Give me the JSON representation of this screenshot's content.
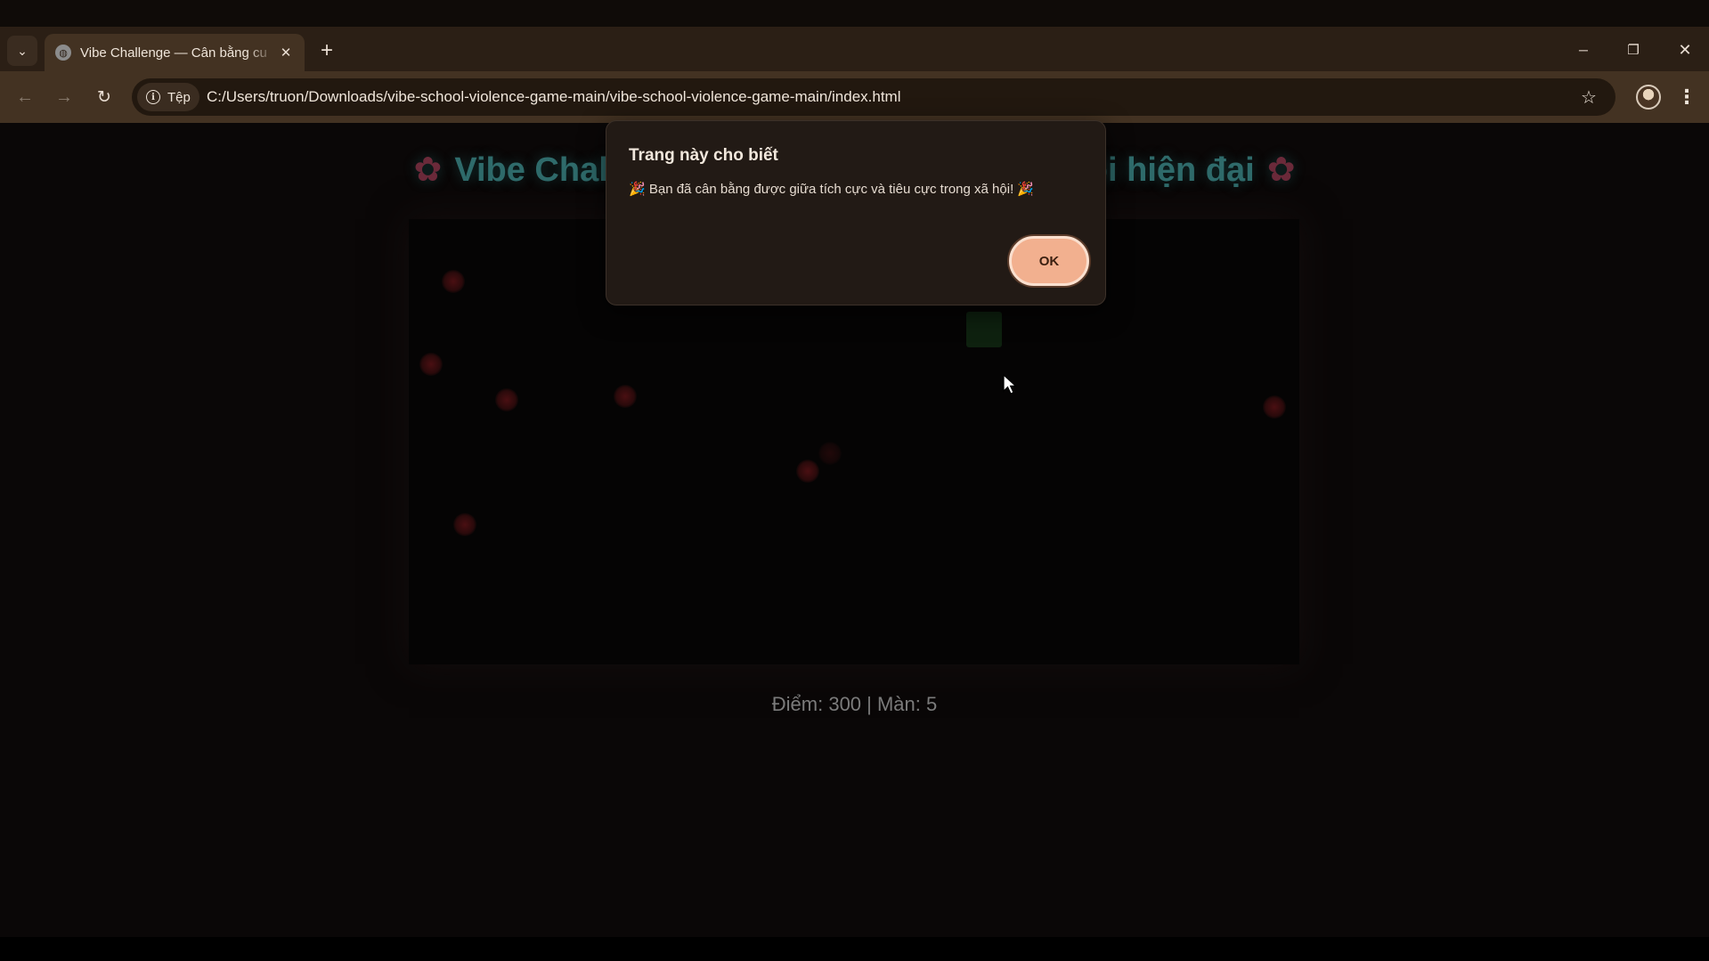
{
  "browser": {
    "tab": {
      "title": "Vibe Challenge — Cân bằng cu",
      "close_glyph": "✕"
    },
    "new_tab_glyph": "+",
    "tab_search_glyph": "⌄",
    "window_controls": {
      "minimize": "─",
      "maximize": "❐",
      "close": "✕"
    },
    "nav": {
      "back": "←",
      "forward": "→",
      "reload": "↻"
    },
    "address_bar": {
      "site_chip_label": "Tệp",
      "url": "C:/Users/truon/Downloads/vibe-school-violence-game-main/vibe-school-violence-game-main/index.html",
      "star_glyph": "☆"
    },
    "menu_glyph": "⋮",
    "theme_colors": {
      "tabstrip": "#2b1f15",
      "toolbar": "#433222",
      "omnibox": "#22180f"
    }
  },
  "page": {
    "title_left": "Vibe Chal",
    "title_right": "ội hiện đại",
    "flower_glyph": "✿",
    "score_text": "Điểm: 300 | Màn: 5",
    "board": {
      "negative_count_visible": 8,
      "colors": {
        "negative": "#4a0f12",
        "player": "#0e210f"
      }
    }
  },
  "dialog": {
    "title": "Trang này cho biết",
    "message": "🎉 Bạn đã cân bằng được giữa tích cực và tiêu cực trong xã hội! 🎉",
    "ok_label": "OK",
    "ok_color": "#f2b08f"
  }
}
